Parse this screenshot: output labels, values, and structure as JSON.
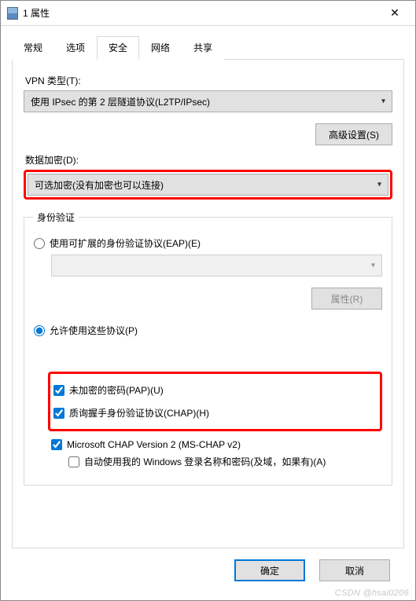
{
  "window": {
    "title": "1 属性",
    "close_symbol": "✕"
  },
  "tabs": {
    "general": "常规",
    "options": "选项",
    "security": "安全",
    "network": "网络",
    "sharing": "共享"
  },
  "security": {
    "vpn_type_label": "VPN 类型(T):",
    "vpn_type_value": "使用 IPsec 的第 2 层隧道协议(L2TP/IPsec)",
    "advanced_button": "高级设置(S)",
    "data_encryption_label": "数据加密(D):",
    "data_encryption_value": "可选加密(没有加密也可以连接)",
    "auth_group_legend": "身份验证",
    "radio_eap_label": "使用可扩展的身份验证协议(EAP)(E)",
    "eap_properties_button": "属性(R)",
    "radio_protocols_label": "允许使用这些协议(P)",
    "chk_pap_label": "未加密的密码(PAP)(U)",
    "chk_chap_label": "质询握手身份验证协议(CHAP)(H)",
    "chk_mschap_label": "Microsoft CHAP Version 2 (MS-CHAP v2)",
    "chk_mschap_auto_label": "自动使用我的 Windows 登录名称和密码(及域，如果有)(A)"
  },
  "footer": {
    "ok": "确定",
    "cancel": "取消"
  },
  "watermark": "CSDN @hsai0206"
}
